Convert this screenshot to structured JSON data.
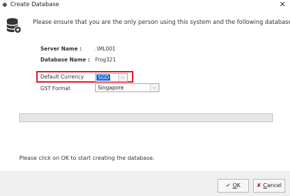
{
  "window": {
    "title": "Create Database",
    "close_glyph": "✕"
  },
  "intro_text": "Please ensure that you are the only person using this system and the following database:",
  "server": {
    "label": "Server Name :",
    "value": ".\\ML001"
  },
  "database": {
    "label": "Database Name :",
    "value": "Frog321"
  },
  "currency": {
    "label": "Default Currency",
    "value": "SGD"
  },
  "gst": {
    "label": "GST Format",
    "value": "Singapore"
  },
  "progress": {
    "value": 0
  },
  "footer_message": "Please click on OK to start creating the database.",
  "buttons": {
    "ok": {
      "mnemonic": "O",
      "rest": "K",
      "icon": "✔"
    },
    "cancel": {
      "mnemonic": "C",
      "rest": "ancel",
      "icon": "✘"
    }
  },
  "colors": {
    "highlight": "#e0141c",
    "selection": "#0a64d8",
    "ok_icon": "#2a8f2a",
    "cancel_icon": "#cc1010"
  },
  "icons": [
    "database-icon",
    "chevron-down-icon",
    "check-icon",
    "x-icon",
    "close-icon"
  ]
}
